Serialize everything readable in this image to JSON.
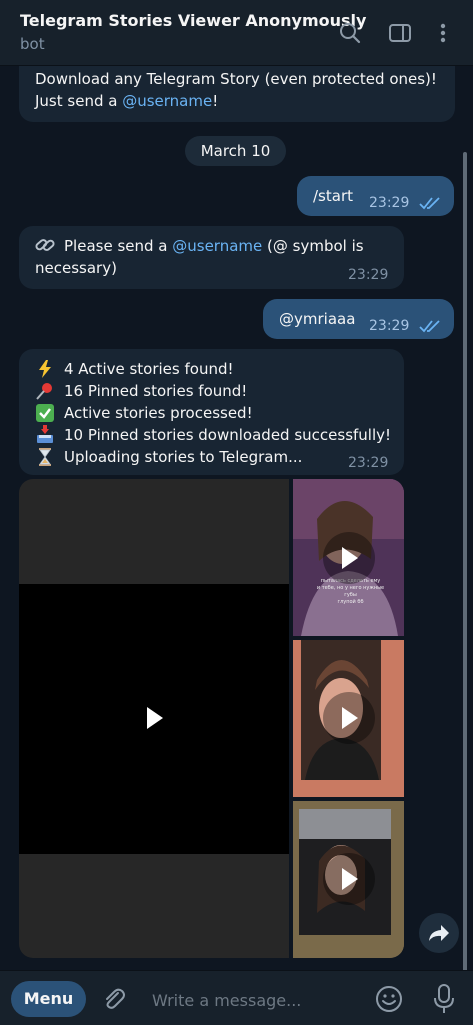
{
  "header": {
    "title": "Telegram Stories Viewer Anonymously",
    "subtitle": "bot"
  },
  "messages": {
    "intro": {
      "line1": "Download any Telegram Story (even protected ones)!",
      "line2_prefix": "Just send a ",
      "line2_link": "@username",
      "line2_suffix": "!"
    },
    "date_separator": "March 10",
    "start": {
      "text": "/start",
      "time": "23:29"
    },
    "please_send": {
      "prefix": "Please send a ",
      "link": "@username",
      "suffix": " (@ symbol is",
      "line2": "necessary)",
      "time": "23:29"
    },
    "user_reply": {
      "text": "@ymriaaa",
      "time": "23:29"
    },
    "status": {
      "lines": [
        "4 Active stories found!",
        "16 Pinned stories found!",
        "Active stories processed!",
        "10 Pinned stories downloaded successfully!",
        "Uploading stories to Telegram..."
      ],
      "icons": [
        "lightning-icon",
        "pushpin-icon",
        "check-box-icon",
        "inbox-tray-icon",
        "hourglass-icon"
      ],
      "time": "23:29"
    }
  },
  "media_overlay_text": [
    "пыталась сделать ему",
    "и тебе, но у него нужные",
    "губы",
    "глупой бб"
  ],
  "composer": {
    "menu_label": "Menu",
    "placeholder": "Write a message..."
  },
  "colors": {
    "background": "#0e1621",
    "bubble_in": "#182533",
    "bubble_out": "#2b5278",
    "link": "#6ab3f3"
  }
}
